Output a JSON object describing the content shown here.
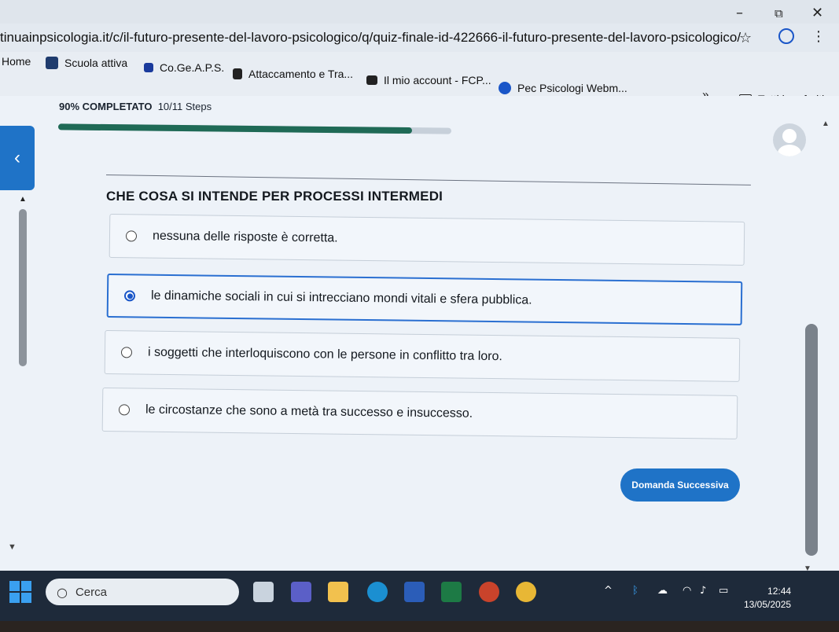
{
  "browser": {
    "url": "tinuainpsicologia.it/c/il-futuro-presente-del-lavoro-psicologico/q/quiz-finale-id-422666-il-futuro-presente-del-lavoro-psicologico/",
    "window_minimize": "–",
    "window_restore": "⧉",
    "window_close": "✕",
    "star_icon": "☆",
    "menu_icon": "⋮",
    "bookmarks": [
      {
        "label": "Home"
      },
      {
        "label": "Scuola attiva",
        "icon_color": "#1f3c6e"
      },
      {
        "label": "Co.Ge.A.P.S.",
        "icon_color": "#1a3a9c"
      },
      {
        "label": "Attaccamento e Tra...",
        "icon_color": "#222222"
      },
      {
        "label": "Il mio account - FCP...",
        "icon_color": "#222222"
      },
      {
        "label": "Pec Psicologi Webm...",
        "icon_color": "#1a56c8"
      }
    ],
    "bookmarks_more": "»",
    "all_bookmarks": "Tutti i preferiti"
  },
  "quiz": {
    "progress_percent_label": "90% COMPLETATO",
    "progress_steps": "10/11 Steps",
    "progress_fraction": 0.9,
    "back_icon": "‹",
    "question": "CHE COSA SI INTENDE PER PROCESSI INTERMEDI",
    "answers": [
      {
        "text": "nessuna delle risposte è corretta.",
        "selected": false
      },
      {
        "text": "le dinamiche sociali in cui si intrecciano mondi vitali e sfera pubblica.",
        "selected": true
      },
      {
        "text": "i soggetti che interloquiscono con le persone in conflitto tra loro.",
        "selected": false
      },
      {
        "text": "le circostanze che sono a metà tra successo e insuccesso.",
        "selected": false
      }
    ],
    "next_button": "Domanda Successiva"
  },
  "taskbar": {
    "search_placeholder": "Cerca",
    "time": "12:44",
    "date": "13/05/2025",
    "tray_chevron": "^",
    "accent": "#1e2a3a"
  },
  "colors": {
    "primary_blue": "#1f73c7",
    "progress_green": "#1f6a56",
    "selected_border": "#2a6fd1"
  }
}
